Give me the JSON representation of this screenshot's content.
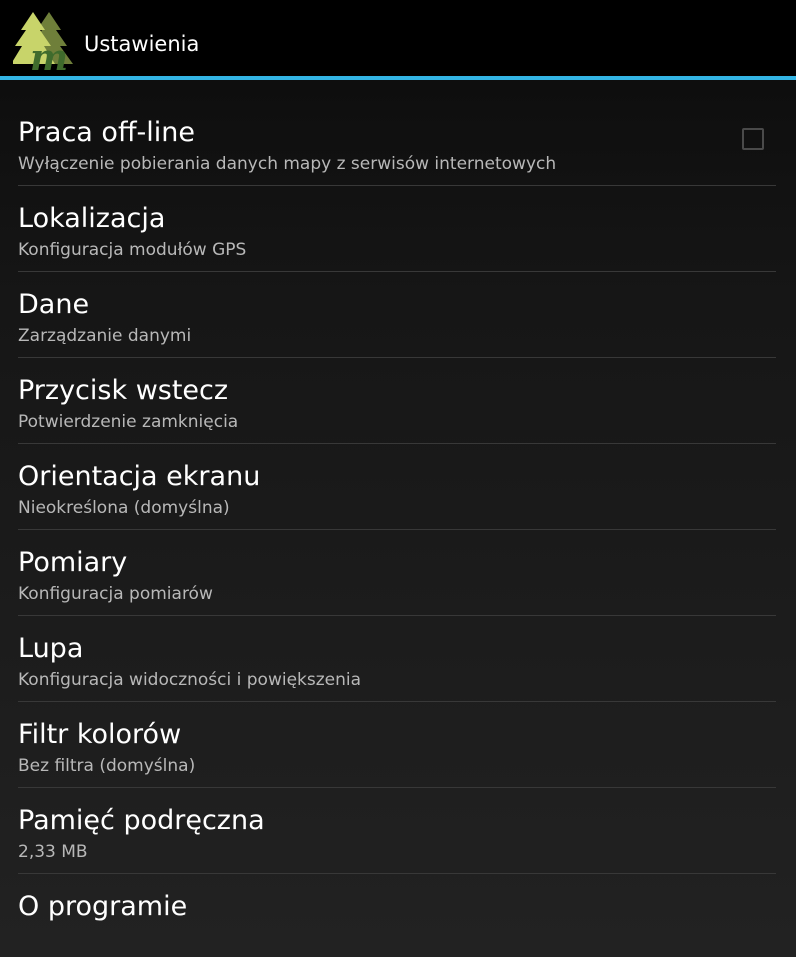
{
  "action_bar": {
    "title": "Ustawienia",
    "icon": "trees-m-logo",
    "accent_color": "#33b5e5"
  },
  "preferences": [
    {
      "title": "Praca off-line",
      "summary": "Wyłączenie pobierania danych mapy z serwisów internetowych",
      "checkbox": true,
      "checked": false
    },
    {
      "title": "Lokalizacja",
      "summary": "Konfiguracja modułów GPS"
    },
    {
      "title": "Dane",
      "summary": "Zarządzanie danymi"
    },
    {
      "title": "Przycisk wstecz",
      "summary": "Potwierdzenie zamknięcia"
    },
    {
      "title": "Orientacja ekranu",
      "summary": "Nieokreślona (domyślna)"
    },
    {
      "title": "Pomiary",
      "summary": "Konfiguracja pomiarów"
    },
    {
      "title": "Lupa",
      "summary": "Konfiguracja widoczności i powiększenia"
    },
    {
      "title": "Filtr kolorów",
      "summary": "Bez filtra (domyślna)"
    },
    {
      "title": "Pamięć podręczna",
      "summary": "2,33 MB"
    },
    {
      "title": "O programie",
      "summary": ""
    }
  ]
}
